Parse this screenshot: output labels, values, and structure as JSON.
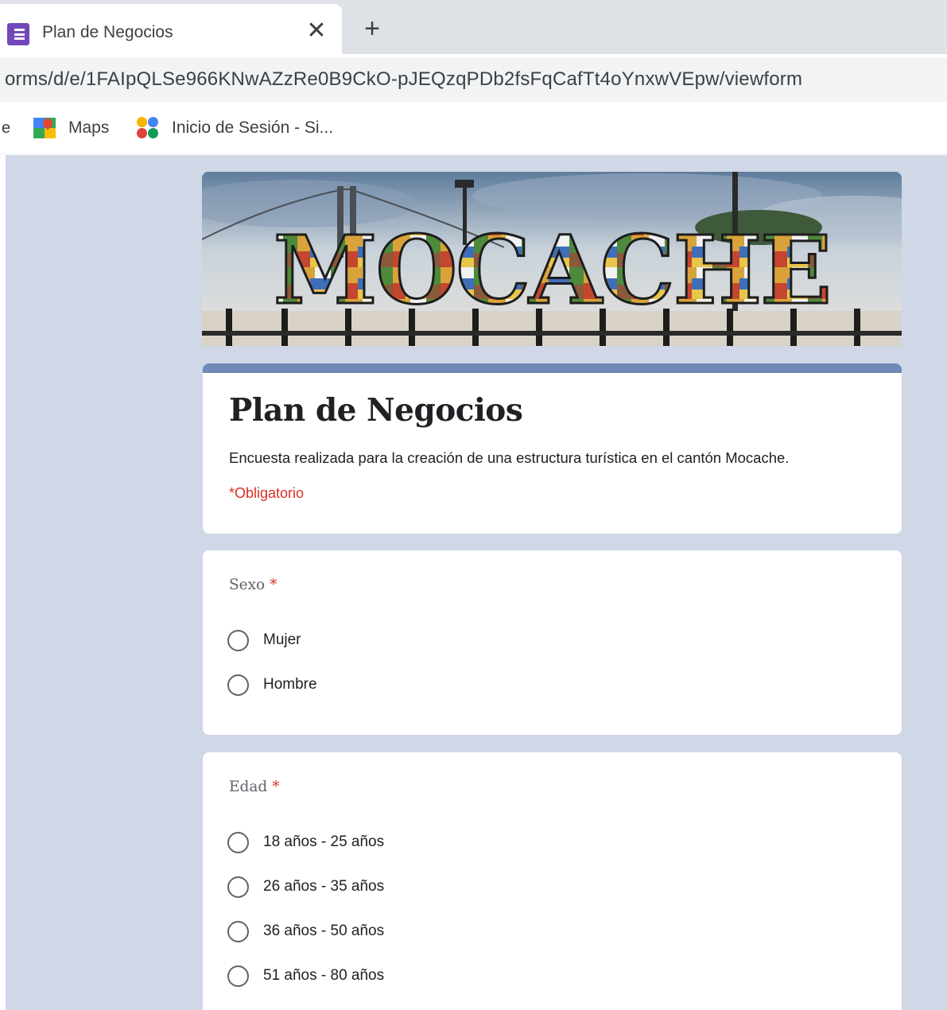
{
  "browser": {
    "tab": {
      "title": "Plan de Negocios",
      "favicon": "google-forms-icon",
      "close_icon": "close-icon"
    },
    "new_tab_icon": "plus-icon",
    "address": {
      "url": "orms/d/e/1FAIpQLSe966KNwAZzRe0B9CkO-pJEQzqPDb2fsFqCafTt4oYnxwVEpw/viewform"
    },
    "bookmarks": {
      "edge_fragment": "e",
      "items": [
        {
          "label": "Maps",
          "icon": "google-maps-icon"
        },
        {
          "label": "Inicio de Sesión - Si...",
          "icon": "siu-icon"
        }
      ]
    }
  },
  "form": {
    "accent_color": "#6f89b8",
    "background_color": "#d0d8e7",
    "banner": {
      "text": "MOCACHE"
    },
    "header": {
      "title": "Plan de Negocios",
      "description": "Encuesta realizada para la creación de una estructura turística en el cantón Mocache.",
      "required_note": "*Obligatorio"
    },
    "questions": [
      {
        "title": "Sexo",
        "required_mark": "*",
        "options": [
          "Mujer",
          "Hombre"
        ]
      },
      {
        "title": "Edad",
        "required_mark": "*",
        "options": [
          "18 años - 25 años",
          "26 años - 35 años",
          "36 años - 50 años",
          "51 años - 80 años"
        ]
      }
    ]
  }
}
